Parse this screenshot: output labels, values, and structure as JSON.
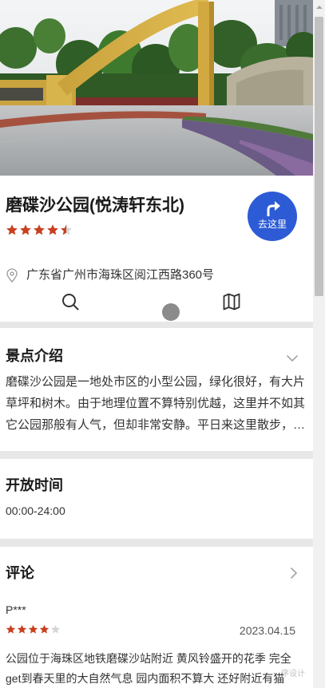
{
  "place": {
    "title": "磨碟沙公园(悦涛轩东北)",
    "rating": 4.5,
    "address": "广东省广州市海珠区阅江西路360号",
    "address_icon": "location-pin-icon"
  },
  "go_button": {
    "label": "去这里",
    "icon": "turn-right-arrow-icon"
  },
  "toolbar": {
    "search_icon": "search-icon",
    "map_icon": "map-icon"
  },
  "intro": {
    "title": "景点介绍",
    "text": "磨碟沙公园是一地处市区的小型公园，绿化很好，有大片草坪和树木。由于地理位置不算特别优越，这里并不如其它公园那般有人气，但却非常安静。平日来这里散步，…",
    "toggle_icon": "chevron-down-icon"
  },
  "hours": {
    "title": "开放时间",
    "value": "00:00-24:00"
  },
  "reviews": {
    "title": "评论",
    "more_icon": "chevron-right-icon",
    "items": [
      {
        "user": "P***",
        "rating": 4,
        "date": "2023.04.15",
        "text_lines": [
          "公园位于海珠区地铁磨碟沙站附近 黄风铃盛开的花季 完全",
          "get到春天里的大自然气息 园内面积不算大 还好附近有猫"
        ]
      }
    ]
  },
  "watermark": "序设计",
  "colors": {
    "accent": "#2d5bd6",
    "star": "#c8401e",
    "star_empty": "#d6d6d6",
    "divider": "#e7e7e7"
  }
}
